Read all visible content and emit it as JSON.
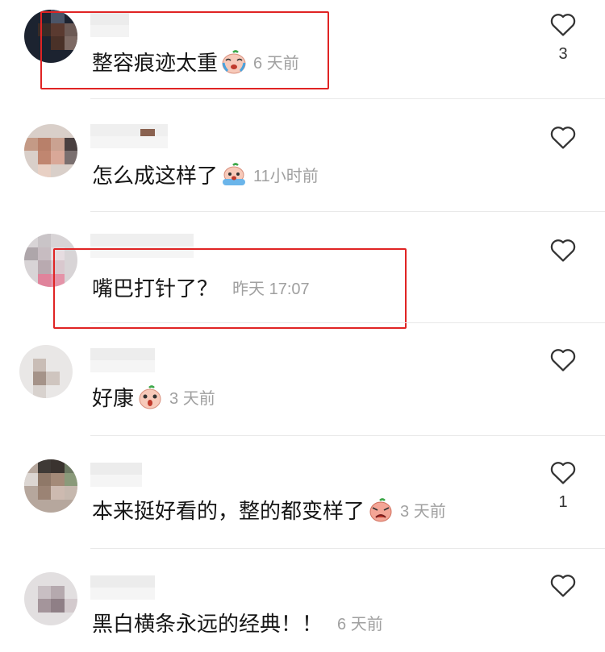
{
  "comments": [
    {
      "text": "整容痕迹太重",
      "time": "6 天前",
      "likes": "3",
      "emoji": "crying-emoji"
    },
    {
      "text": "怎么成这样了",
      "time": "11小时前",
      "likes": "",
      "emoji": "sobbing-emoji"
    },
    {
      "text": "嘴巴打针了？",
      "time": "昨天 17:07",
      "likes": "",
      "emoji": ""
    },
    {
      "text": "好康",
      "time": "3 天前",
      "likes": "",
      "emoji": "shocked-emoji"
    },
    {
      "text": "本来挺好看的，整的都变样了",
      "time": "3 天前",
      "likes": "1",
      "emoji": "grumpy-emoji"
    },
    {
      "text": "黑白横条永远的经典！！",
      "time": "6 天前",
      "likes": "",
      "emoji": ""
    }
  ],
  "highlight_color": "#e02424",
  "icons": {
    "like": "heart-outline-icon"
  }
}
